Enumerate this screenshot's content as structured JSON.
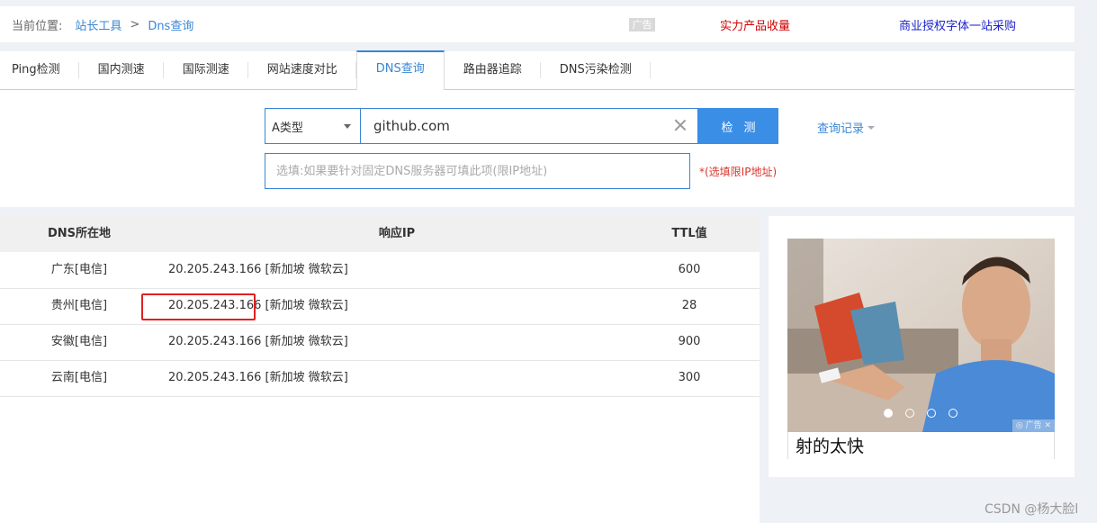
{
  "breadcrumb": {
    "label": "当前位置:",
    "items": [
      "站长工具",
      "Dns查询"
    ],
    "separator": ">"
  },
  "top_ads": {
    "tag": "广告",
    "link1": "实力产品收量",
    "link2": "商业授权字体一站采购"
  },
  "tabs": [
    {
      "label": "Ping检测"
    },
    {
      "label": "国内测速"
    },
    {
      "label": "国际测速"
    },
    {
      "label": "网站速度对比"
    },
    {
      "label": "DNS查询"
    },
    {
      "label": "路由器追踪"
    },
    {
      "label": "DNS污染检测"
    }
  ],
  "query": {
    "record_type": "A类型",
    "domain": "github.com",
    "check_button": "检测",
    "history": "查询记录",
    "server_placeholder": "选填:如果要针对固定DNS服务器可填此项(限IP地址)",
    "server_note": "*(选填限IP地址)"
  },
  "table": {
    "headers": {
      "location": "DNS所在地",
      "ip": "响应IP",
      "ttl": "TTL值"
    },
    "rows": [
      {
        "location": "广东[电信]",
        "ip": "20.205.243.166 [新加坡 微软云]",
        "ttl": "600"
      },
      {
        "location": "贵州[电信]",
        "ip": "20.205.243.166 [新加坡 微软云]",
        "ttl": "28"
      },
      {
        "location": "安徽[电信]",
        "ip": "20.205.243.166 [新加坡 微软云]",
        "ttl": "900"
      },
      {
        "location": "云南[电信]",
        "ip": "20.205.243.166 [新加坡 微软云]",
        "ttl": "300"
      }
    ]
  },
  "side_ad": {
    "caption": "射的太快",
    "mini_tag": "广告",
    "slides": 4,
    "active_slide": 1
  },
  "watermark": "CSDN @杨大脸l",
  "colors": {
    "accent": "#3a86d4",
    "button": "#3a8ee6",
    "highlight": "#e02020",
    "note": "#d9342b"
  }
}
